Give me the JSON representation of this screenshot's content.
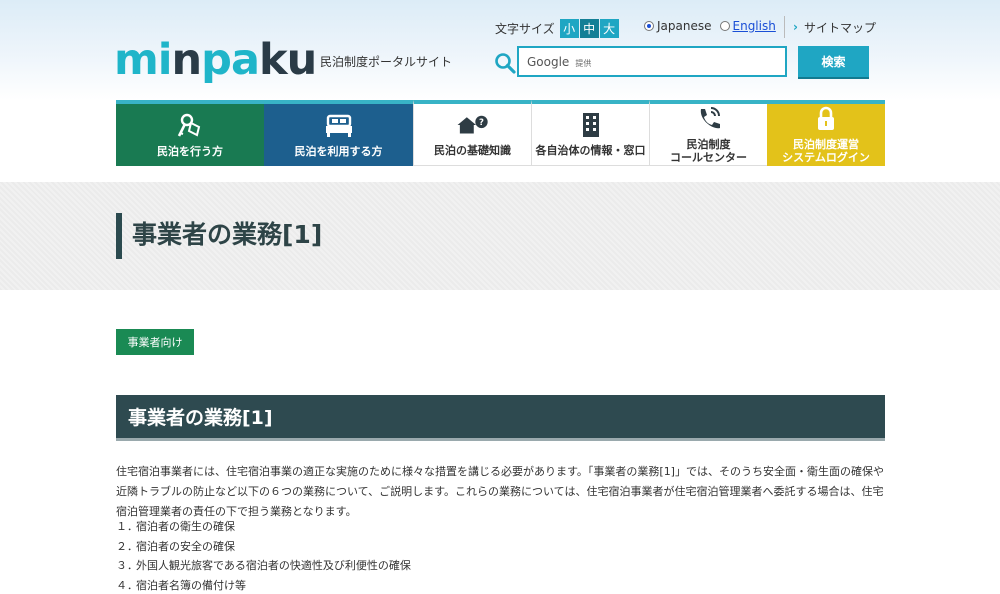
{
  "header": {
    "logo": {
      "p1": "mi",
      "p2": "n",
      "p3": "pa",
      "p4": "ku"
    },
    "tagline": "民泊制度ポータルサイト",
    "font_size": {
      "label": "文字サイズ",
      "options": [
        "小",
        "中",
        "大"
      ]
    },
    "language": {
      "japanese": "Japanese",
      "english": "English",
      "selected": "Japanese"
    },
    "sitemap": "サイトマップ",
    "search": {
      "brand": "Google",
      "provided": "提供",
      "button": "検索"
    }
  },
  "nav": {
    "items": [
      {
        "label": "民泊を行う方",
        "icon": "keys-icon"
      },
      {
        "label": "民泊を利用する方",
        "icon": "bed-icon"
      },
      {
        "label": "民泊の基礎知識",
        "icon": "house-question-icon"
      },
      {
        "label": "各自治体の情報・窓口",
        "icon": "building-icon"
      },
      {
        "label_line1": "民泊制度",
        "label_line2": "コールセンター",
        "icon": "phone-icon"
      },
      {
        "label_line1": "民泊制度運営",
        "label_line2": "システムログイン",
        "icon": "lock-icon"
      }
    ]
  },
  "page": {
    "title": "事業者の業務[1]",
    "tag": "事業者向け",
    "section_heading": "事業者の業務[1]",
    "intro": "住宅宿泊事業者には、住宅宿泊事業の適正な実施のために様々な措置を講じる必要があります。「事業者の業務[1]」では、そのうち安全面・衛生面の確保や近隣トラブルの防止など以下の６つの業務について、ご説明します。これらの業務については、住宅宿泊事業者が住宅宿泊管理業者へ委託する場合は、住宅宿泊管理業者の責任の下で担う業務となります。",
    "list": [
      {
        "num": "１．",
        "text": "宿泊者の衛生の確保"
      },
      {
        "num": "２．",
        "text": "宿泊者の安全の確保"
      },
      {
        "num": "３．",
        "text": "外国人観光旅客である宿泊者の快適性及び利便性の確保"
      },
      {
        "num": "４．",
        "text": "宿泊者名簿の備付け等"
      }
    ]
  },
  "colors": {
    "accent": "#1fa6c3",
    "green": "#197a52",
    "blue": "#1d5f8e",
    "yellow": "#e3c21a",
    "dark": "#2e4a50"
  }
}
